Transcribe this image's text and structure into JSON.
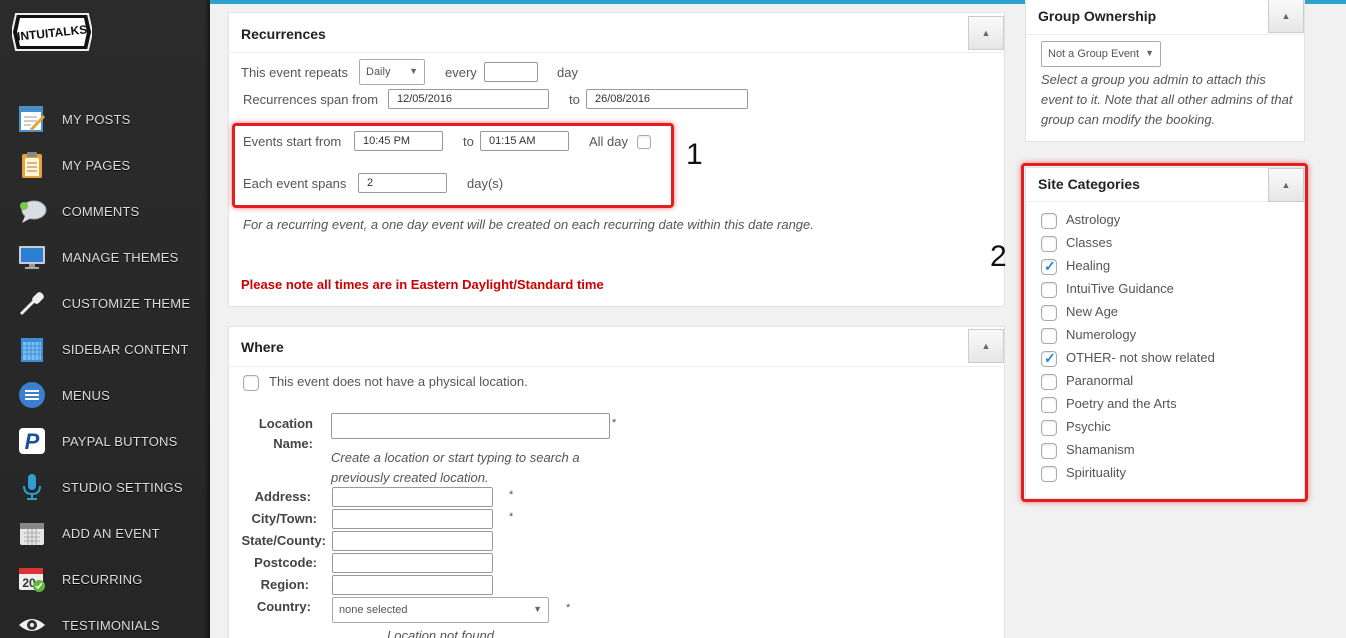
{
  "colors": {
    "accent": "#2ea2cc",
    "highlight": "#e02020",
    "note_red": "#cc0000",
    "check": "#1e8cbe"
  },
  "brand": {
    "logo_text": "INTUITALKS"
  },
  "sidebar": {
    "items": [
      {
        "label": "MY POSTS",
        "icon": "edit-posts-icon"
      },
      {
        "label": "MY PAGES",
        "icon": "clipboard-icon"
      },
      {
        "label": "COMMENTS",
        "icon": "speech-bubble-icon"
      },
      {
        "label": "MANAGE THEMES",
        "icon": "monitor-icon"
      },
      {
        "label": "CUSTOMIZE THEME",
        "icon": "eyedropper-icon"
      },
      {
        "label": "SIDEBAR CONTENT",
        "icon": "grid-icon"
      },
      {
        "label": "MENUS",
        "icon": "menu-list-icon"
      },
      {
        "label": "PAYPAL BUTTONS",
        "icon": "paypal-icon"
      },
      {
        "label": "STUDIO SETTINGS",
        "icon": "microphone-icon"
      },
      {
        "label": "ADD AN EVENT",
        "icon": "calendar-icon"
      },
      {
        "label": "RECURRING",
        "icon": "recurring-calendar-icon"
      },
      {
        "label": "TESTIMONIALS",
        "icon": "eye-icon"
      }
    ]
  },
  "recurrences": {
    "title": "Recurrences",
    "repeats_label": "This event repeats",
    "repeats_value": "Daily",
    "every_label": "every",
    "every_value": "",
    "day_label": "day",
    "span_label": "Recurrences span from",
    "span_from": "12/05/2016",
    "to_label": "to",
    "span_to": "26/08/2016",
    "start_label": "Events start from",
    "start_time": "10:45 PM",
    "end_to_label": "to",
    "end_time": "01:15 AM",
    "all_day_label": "All day",
    "each_span_label": "Each event spans",
    "each_span_value": "2",
    "days_label": "day(s)",
    "info_text": "For a recurring event, a one day event will be created on each recurring date within this date range.",
    "note_text": "Please note all times are in Eastern Daylight/Standard time"
  },
  "annotations": {
    "one": "1",
    "two": "2"
  },
  "where": {
    "title": "Where",
    "no_location_label": "This event does not have a physical location.",
    "location_name_label": "Location Name:",
    "location_help": "Create a location or start typing to search a previously created location.",
    "address_label": "Address:",
    "city_label": "City/Town:",
    "state_label": "State/County:",
    "postcode_label": "Postcode:",
    "region_label": "Region:",
    "country_label": "Country:",
    "country_value": "none selected",
    "required_mark": "*",
    "not_found": "Location not found"
  },
  "group": {
    "title": "Group Ownership",
    "select_value": "Not a Group Event",
    "help": "Select a group you admin to attach this event to it. Note that all other admins of that group can modify the booking."
  },
  "categories": {
    "title": "Site Categories",
    "items": [
      {
        "label": "Astrology",
        "checked": false
      },
      {
        "label": "Classes",
        "checked": false
      },
      {
        "label": "Healing",
        "checked": true
      },
      {
        "label": "IntuiTive Guidance",
        "checked": false
      },
      {
        "label": "New Age",
        "checked": false
      },
      {
        "label": "Numerology",
        "checked": false
      },
      {
        "label": "OTHER- not show related",
        "checked": true
      },
      {
        "label": "Paranormal",
        "checked": false
      },
      {
        "label": "Poetry and the Arts",
        "checked": false
      },
      {
        "label": "Psychic",
        "checked": false
      },
      {
        "label": "Shamanism",
        "checked": false
      },
      {
        "label": "Spirituality",
        "checked": false
      }
    ]
  }
}
